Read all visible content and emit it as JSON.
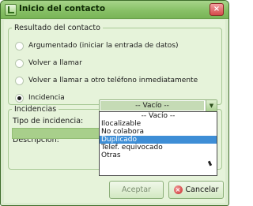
{
  "window": {
    "title": "Inicio del contacto",
    "close_glyph": "×",
    "icon": "contact-app-icon"
  },
  "resultado": {
    "legend": "Resultado del contacto",
    "options": [
      {
        "label": "Argumentado (iniciar la entrada de datos)",
        "checked": false
      },
      {
        "label": "Volver a llamar",
        "checked": false
      },
      {
        "label": "Volver a llamar a otro teléfono inmediatamente",
        "checked": false
      },
      {
        "label": "Incidencia",
        "checked": true
      }
    ]
  },
  "incidencias": {
    "legend": "Incidencias",
    "tipo_label": "Tipo de incidencia:",
    "tipo_value": "-- Vacío --",
    "descripcion_label": "Descripcion:",
    "dropdown_options": [
      {
        "label": "-- Vacío --",
        "selected": false
      },
      {
        "label": "Ilocalizable",
        "selected": false
      },
      {
        "label": "No colabora",
        "selected": false
      },
      {
        "label": "Duplicado",
        "selected": true
      },
      {
        "label": "Telef. equivocado",
        "selected": false
      },
      {
        "label": "Otras",
        "selected": false
      }
    ]
  },
  "buttons": {
    "accept_label": "Aceptar",
    "cancel_label": "Cancelar",
    "cancel_underline": "C"
  },
  "colors": {
    "titlebar": "#88c167",
    "background": "#e6f3da",
    "selection": "#3e8ed6"
  }
}
